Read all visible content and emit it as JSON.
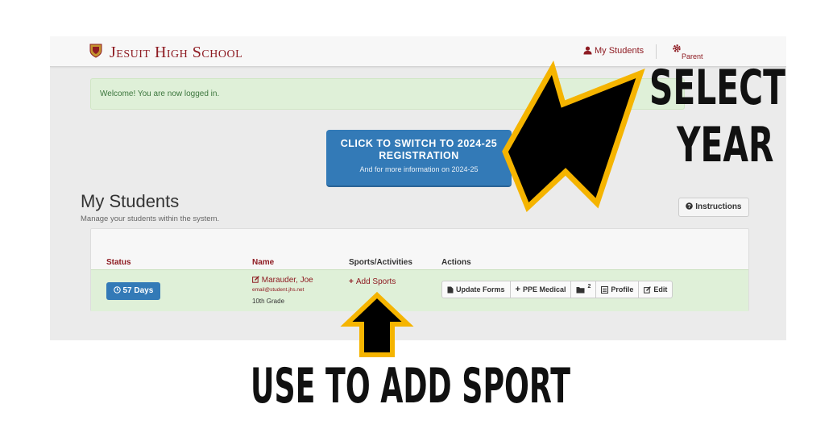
{
  "topbar": {
    "brand": "Jesuit High School",
    "my_students": "My Students",
    "parent": "Parent",
    "icons": {
      "logo": "crest-icon",
      "students": "user-icon",
      "settings": "gear-icon"
    }
  },
  "alert": {
    "message": "Welcome! You are now logged in."
  },
  "switch_button": {
    "line1": "CLICK TO SWITCH TO 2024-25",
    "line2": "REGISTRATION",
    "line3": "And for more information on 2024-25"
  },
  "page": {
    "title": "My Students",
    "subtitle": "Manage your students within the system.",
    "instructions_label": "Instructions"
  },
  "table": {
    "headers": {
      "status": "Status",
      "name": "Name",
      "sports": "Sports/Activities",
      "actions": "Actions"
    },
    "rows": [
      {
        "days": "57 Days",
        "name": "Marauder, Joe",
        "email": "email@student.jhs.net",
        "grade": "10th Grade",
        "add_sports": "Add Sports",
        "actions": {
          "update_forms": "Update Forms",
          "ppe_medical": "PPE Medical",
          "folder_count": "2",
          "profile": "Profile",
          "edit": "Edit"
        }
      }
    ]
  },
  "annotations": {
    "select_line1": "SELECT",
    "select_line2": "YEAR",
    "add_sport": "USE TO ADD SPORT"
  },
  "colors": {
    "brand": "#8e1b22",
    "primary_button": "#337ab7",
    "success_bg": "#dff0d8",
    "annotation_arrow_outline": "#f5b400",
    "annotation_arrow_fill": "#000000"
  }
}
